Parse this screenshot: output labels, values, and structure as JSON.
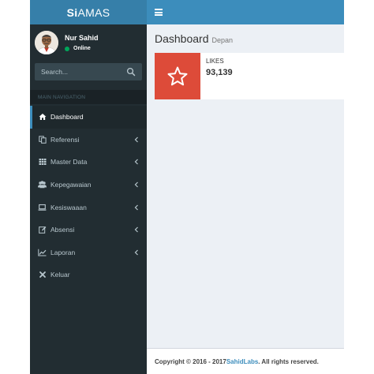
{
  "app": {
    "logo_prefix": "Si",
    "logo_rest": "AMAS"
  },
  "user": {
    "name": "Nur Sahid",
    "status": "Online"
  },
  "search": {
    "placeholder": "Search..."
  },
  "nav": {
    "header": "MAIN NAVIGATION",
    "items": [
      {
        "label": "Dashboard",
        "icon": "home-icon",
        "active": true,
        "has_children": false
      },
      {
        "label": "Referensi",
        "icon": "copy-icon",
        "has_children": true
      },
      {
        "label": "Master Data",
        "icon": "th-icon",
        "has_children": true
      },
      {
        "label": "Kepegawaian",
        "icon": "users-icon",
        "has_children": true
      },
      {
        "label": "Kesiswaaan",
        "icon": "laptop-icon",
        "has_children": true
      },
      {
        "label": "Absensi",
        "icon": "edit-icon",
        "has_children": true
      },
      {
        "label": "Laporan",
        "icon": "line-chart-icon",
        "has_children": true
      },
      {
        "label": "Keluar",
        "icon": "close-icon",
        "has_children": false
      }
    ]
  },
  "page": {
    "title": "Dashboard",
    "subtitle": "Depan"
  },
  "info_box": {
    "label": "LIKES",
    "value": "93,139",
    "icon": "star-icon",
    "color": "#dd4b39"
  },
  "footer": {
    "prefix": "Copyright © 2016 - 2017 ",
    "link": "SahidLabs",
    "suffix": ". All rights reserved."
  },
  "colors": {
    "topbar": "#3c8dbc",
    "logo": "#367fa9",
    "sidebar": "#222d32",
    "content_bg": "#ecf0f5",
    "online": "#00a65a"
  }
}
